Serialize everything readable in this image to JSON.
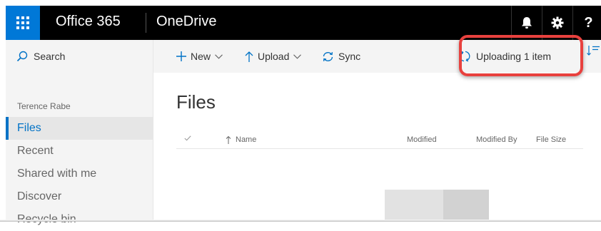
{
  "topbar": {
    "suite_name": "Office 365",
    "app_name": "OneDrive",
    "icons": [
      "waffle-icon",
      "bell-icon",
      "gear-icon",
      "help-icon"
    ],
    "help_label": "?",
    "accent": "#0078d7",
    "background": "#000000"
  },
  "sidebar": {
    "search_label": "Search",
    "user_name": "Terence Rabe",
    "items": [
      {
        "label": "Files",
        "active": true
      },
      {
        "label": "Recent"
      },
      {
        "label": "Shared with me"
      },
      {
        "label": "Discover"
      },
      {
        "label": "Recycle bin"
      }
    ],
    "active_color": "#0072c6"
  },
  "commandbar": {
    "new_label": "New",
    "upload_label": "Upload",
    "sync_label": "Sync",
    "status_label": "Uploading 1 item",
    "highlight_color": "#e8413e"
  },
  "main": {
    "title": "Files",
    "columns": {
      "name": "Name",
      "modified": "Modified",
      "modified_by": "Modified By",
      "file_size": "File Size"
    }
  }
}
